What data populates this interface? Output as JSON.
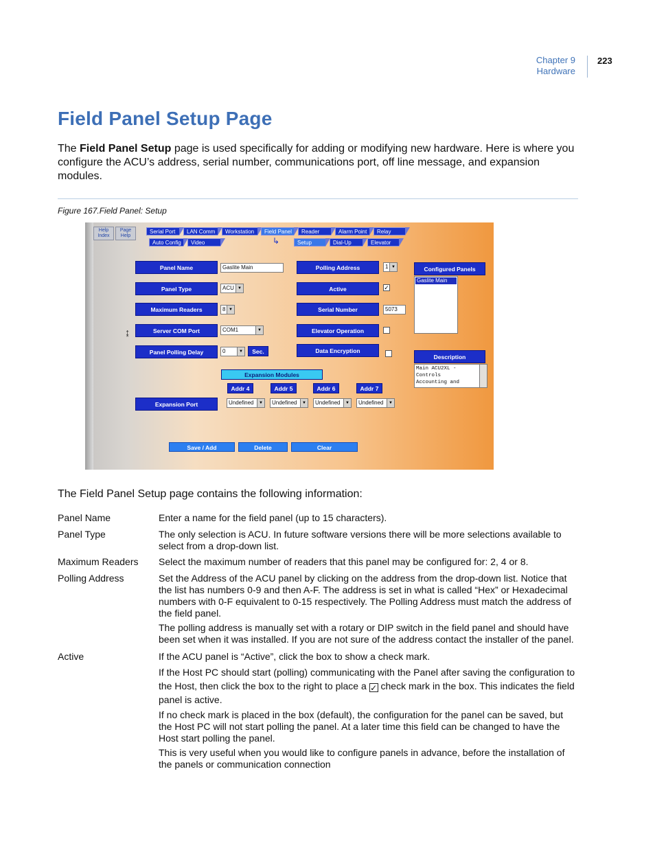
{
  "header": {
    "chapter": "Chapter 9",
    "section": "Hardware",
    "page_number": "223"
  },
  "title": "Field Panel Setup Page",
  "intro": {
    "prefix": "The ",
    "bold": "Field Panel Setup",
    "rest": " page is used specifically for adding or modifying new hardware. Here is where you configure the ACU’s address, serial number, communications port, off line message, and expansion modules."
  },
  "figure_caption": "Figure 167.Field Panel: Setup",
  "screenshot": {
    "help_buttons": [
      "Help Index",
      "Page Help"
    ],
    "tabs_row1": [
      "Serial Port",
      "LAN Comm",
      "Workstation",
      "Field Panel",
      "Reader",
      "Alarm Point",
      "Relay"
    ],
    "tabs_row2": [
      "Auto Config",
      "Video"
    ],
    "subtabs": [
      "Setup",
      "Dial-Up",
      "Elevator"
    ],
    "fields": {
      "panel_name_label": "Panel Name",
      "panel_name_value": "Gaslite Main",
      "panel_type_label": "Panel Type",
      "panel_type_value": "ACU",
      "max_readers_label": "Maximum Readers",
      "max_readers_value": "8",
      "server_com_label": "Server COM Port",
      "server_com_value": "COM1",
      "polling_delay_label": "Panel Polling Delay",
      "polling_delay_value": "0",
      "polling_delay_unit": "Sec.",
      "polling_address_label": "Polling Address",
      "polling_address_value": "1",
      "active_label": "Active",
      "active_checked": true,
      "serial_number_label": "Serial Number",
      "serial_number_value": "5073",
      "elevator_label": "Elevator Operation",
      "elevator_checked": false,
      "encryption_label": "Data Encryption",
      "encryption_checked": false
    },
    "configured_panels_label": "Configured Panels",
    "configured_panels": [
      "Gaslite Main"
    ],
    "description_label": "Description",
    "description_value": "Main ACU2XL -\nControls\nAccounting and",
    "expansion_modules_label": "Expansion Modules",
    "addr_labels": [
      "Addr 4",
      "Addr 5",
      "Addr 6",
      "Addr 7"
    ],
    "expansion_port_label": "Expansion Port",
    "expansion_values": [
      "Undefined",
      "Undefined",
      "Undefined",
      "Undefined"
    ],
    "buttons": {
      "save": "Save / Add",
      "delete": "Delete",
      "clear": "Clear"
    }
  },
  "contains_text": "The Field Panel Setup page contains the following information:",
  "definitions": {
    "panel_name": {
      "term": "Panel Name",
      "desc": "Enter a name for the field panel (up to 15 characters)."
    },
    "panel_type": {
      "term": "Panel Type",
      "desc": "The only selection is ACU. In future software versions there will be more selections available to select from a drop-down list."
    },
    "max_readers": {
      "term": "Maximum Readers",
      "desc": "Select the maximum number of readers that this panel may be configured for: 2, 4 or 8."
    },
    "polling_address": {
      "term": "Polling Address",
      "p1": "Set the Address of the ACU panel by clicking on the address from the drop-down list. Notice that the list has numbers 0-9 and then A-F. The address is set in what is called “Hex” or Hexadecimal numbers with 0-F equivalent to 0-15 respectively. The Polling Address must match the address of the field panel.",
      "p2": "The polling address is manually set with a rotary or DIP switch in the field panel and should have been set when it was installed. If you are not sure of the address contact the installer of the panel."
    },
    "active": {
      "term": "Active",
      "p1": "If the ACU panel is “Active”, click the box to show a check mark.",
      "p2a": "If the Host PC should start (polling) communicating with the Panel after saving the configuration to the Host, then click the box to the right to place a",
      "p2b": "check mark in the box. This indicates the field panel is active.",
      "p3": "If no check mark is placed in the box (default), the configuration for the panel can be saved, but the Host PC will not start polling the panel. At a later time this field can be changed to have the Host start polling the panel.",
      "p4": "This is very useful when you would like to configure panels in advance, before the installation of the panels or communication connection"
    }
  },
  "colors": {
    "heading": "#3d6fb6",
    "label_bg": "#1c2ec8",
    "button_bg": "#2c7ff0",
    "expansion_label_bg": "#39c9f2"
  }
}
